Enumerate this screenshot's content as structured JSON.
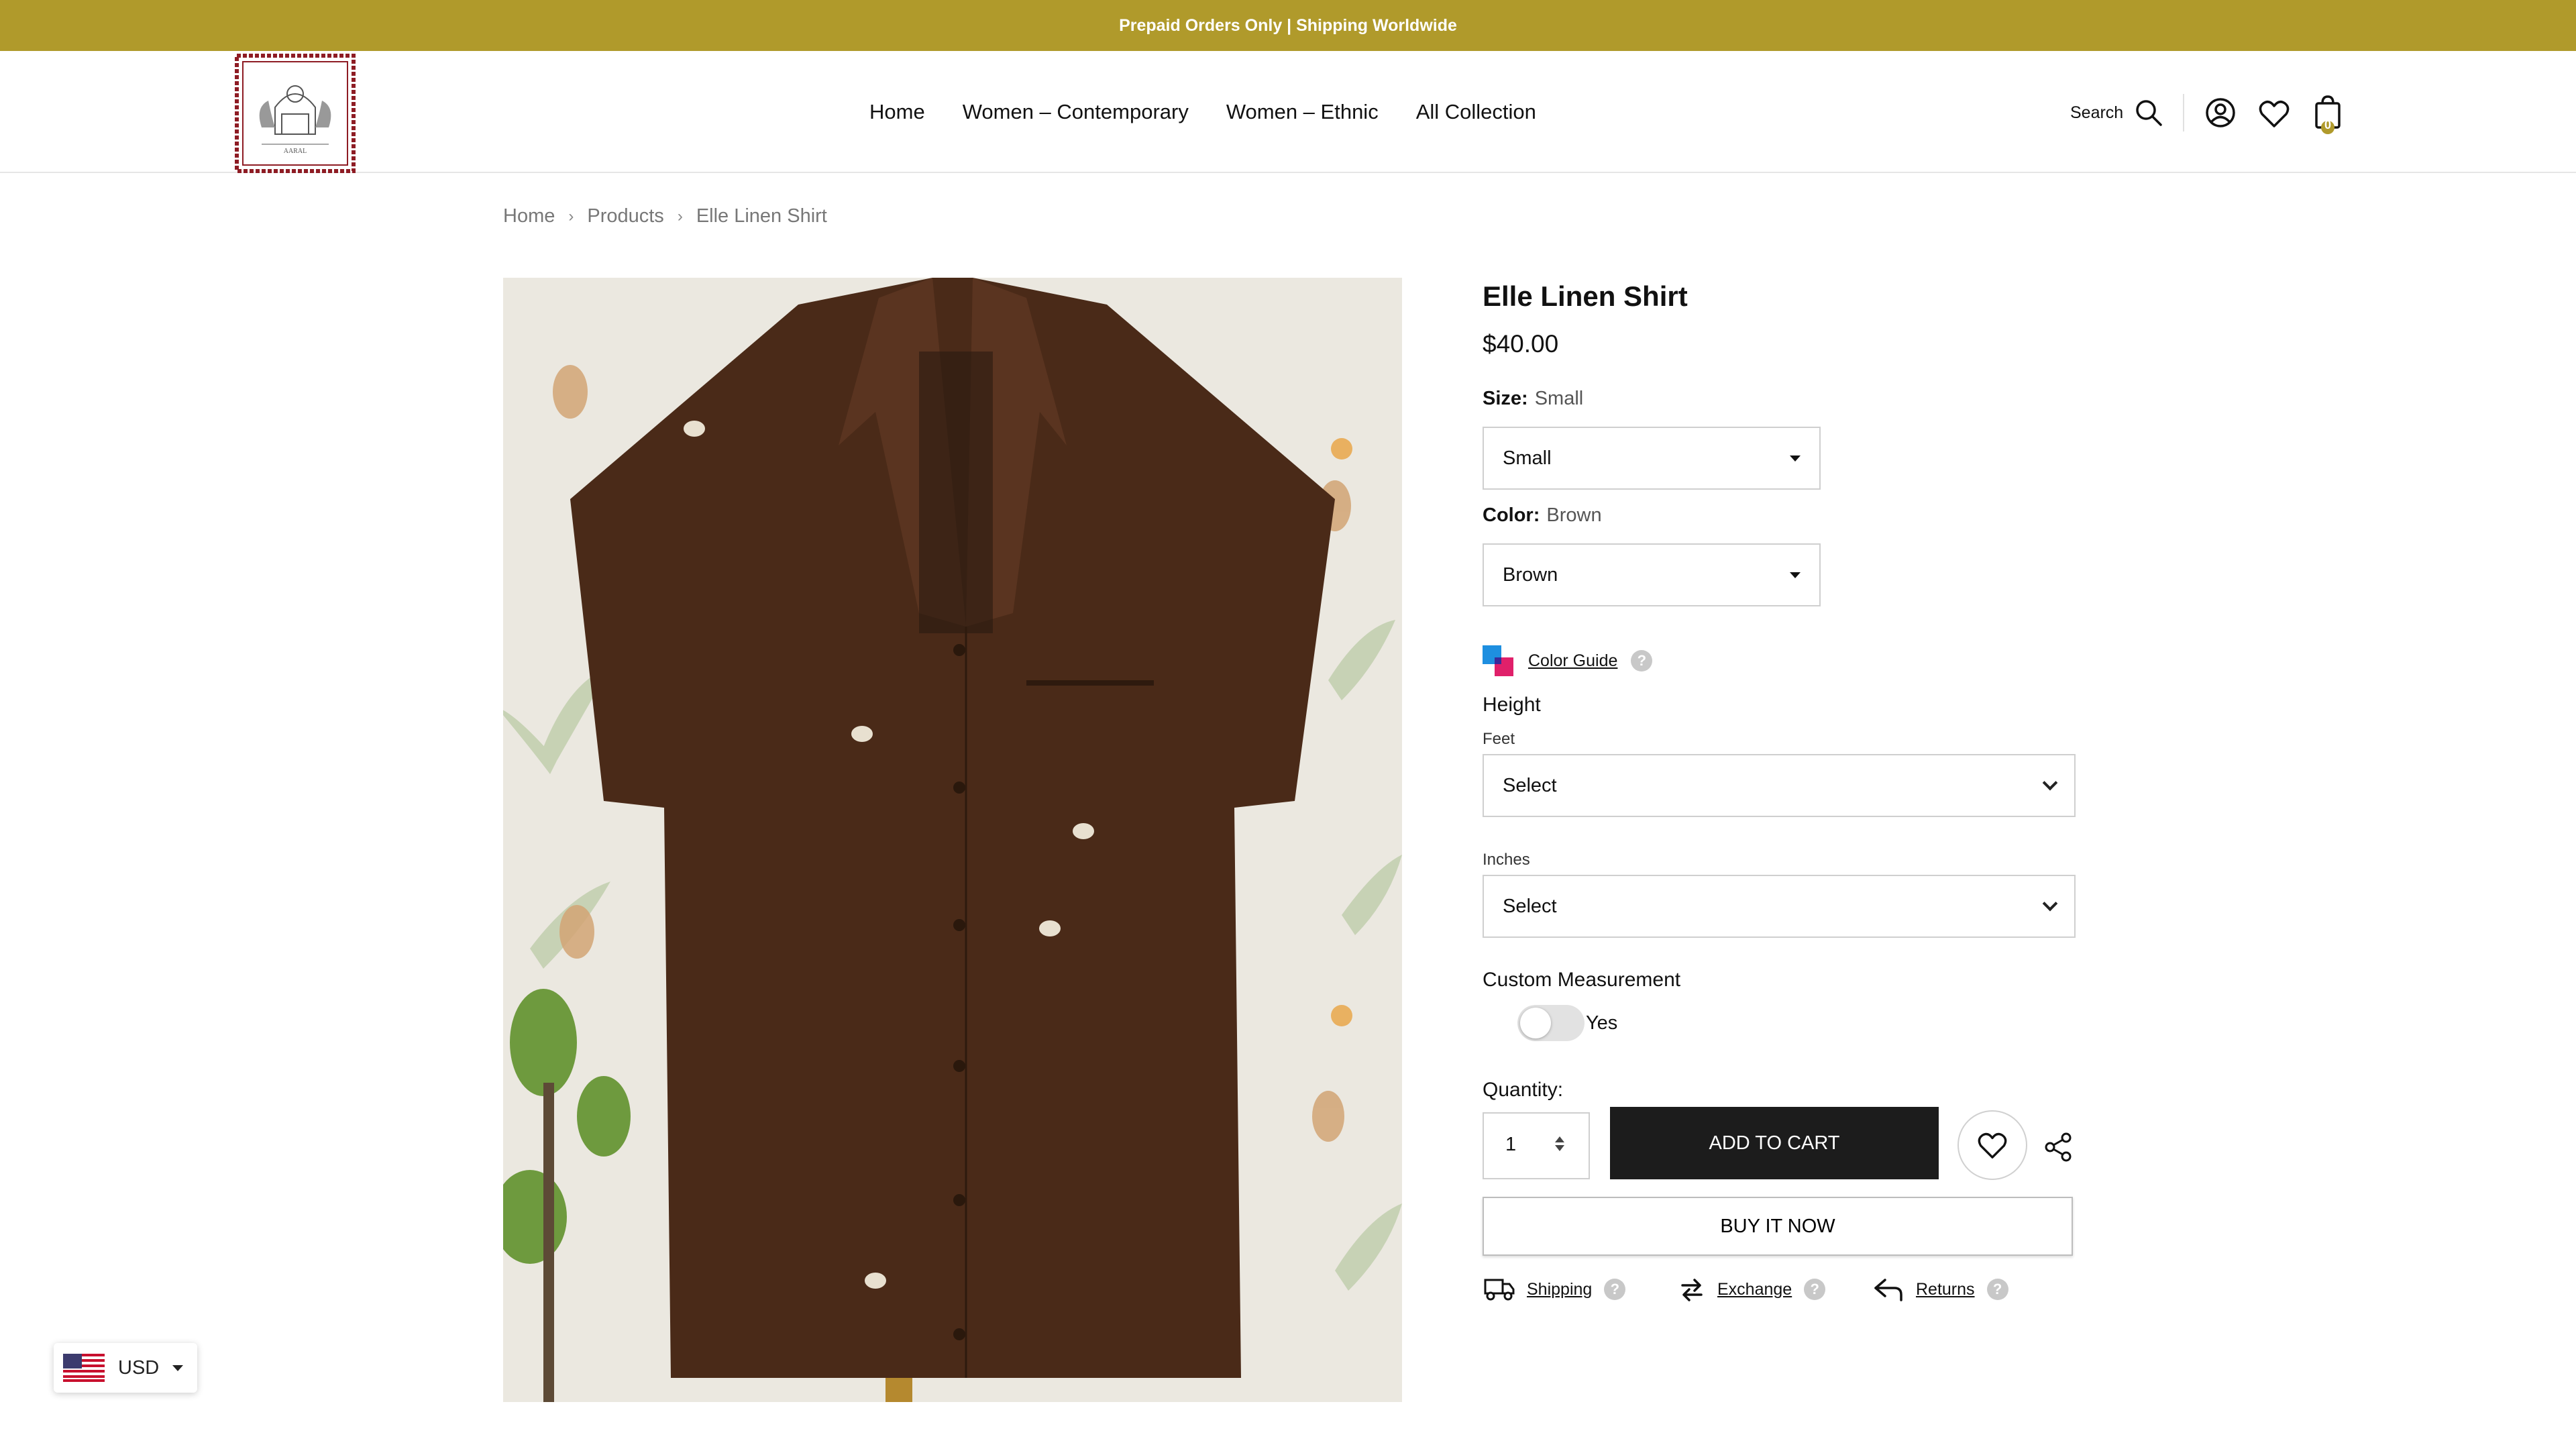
{
  "announcement": "Prepaid Orders Only | Shipping Worldwide",
  "header": {
    "nav": [
      "Home",
      "Women – Contemporary",
      "Women – Ethnic",
      "All Collection"
    ],
    "search_label": "Search",
    "cart_count": "0",
    "logo_text": "AARAL"
  },
  "breadcrumb": [
    "Home",
    "Products",
    "Elle Linen Shirt"
  ],
  "product": {
    "title": "Elle Linen Shirt",
    "price": "$40.00",
    "size_label": "Size:",
    "size_value": "Small",
    "size_selected": "Small",
    "color_label": "Color:",
    "color_value": "Brown",
    "color_selected": "Brown",
    "color_guide": "Color Guide",
    "height_heading": "Height",
    "feet_label": "Feet",
    "feet_selected": "Select",
    "inches_label": "Inches",
    "inches_selected": "Select",
    "custom_measurement": "Custom Measurement",
    "toggle_label": "Yes",
    "quantity_label": "Quantity:",
    "quantity": "1",
    "add_to_cart": "ADD TO CART",
    "buy_now": "BUY IT NOW",
    "policies": [
      "Shipping",
      "Exchange",
      "Returns"
    ]
  },
  "currency": "USD",
  "colors": {
    "announce_bg": "#b09a2b",
    "button_dark": "#1c1c1c",
    "shirt": "#4a2a18"
  }
}
